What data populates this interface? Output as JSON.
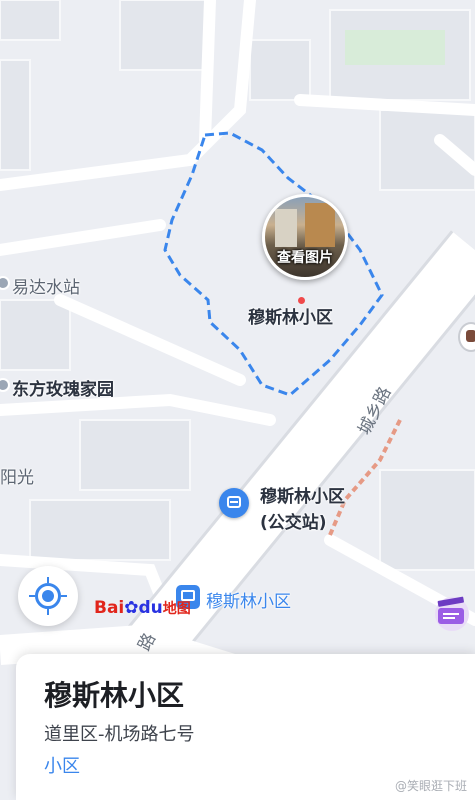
{
  "map": {
    "area_name": "穆斯林小区",
    "photo_caption": "查看图片",
    "road_label": "城乡路",
    "road_label_2": "路",
    "pois": [
      {
        "name": "易达水站"
      },
      {
        "name": "东方玫瑰家园"
      },
      {
        "name": "阳光"
      }
    ],
    "bus_stop": {
      "line1": "穆斯林小区",
      "line2": "(公交站)"
    },
    "bus_stop_2": {
      "name": "穆斯林小区"
    },
    "logo": {
      "bai": "Bai",
      "du": "du",
      "ditu": "地图"
    },
    "colors": {
      "boundary": "#3a86ec",
      "accent": "#3a86ec",
      "road": "#ffffff",
      "land": "#eceef3"
    }
  },
  "card": {
    "title": "穆斯林小区",
    "address": "道里区-机场路七号",
    "category": "小区"
  },
  "watermark": "@笑眼逛下班"
}
